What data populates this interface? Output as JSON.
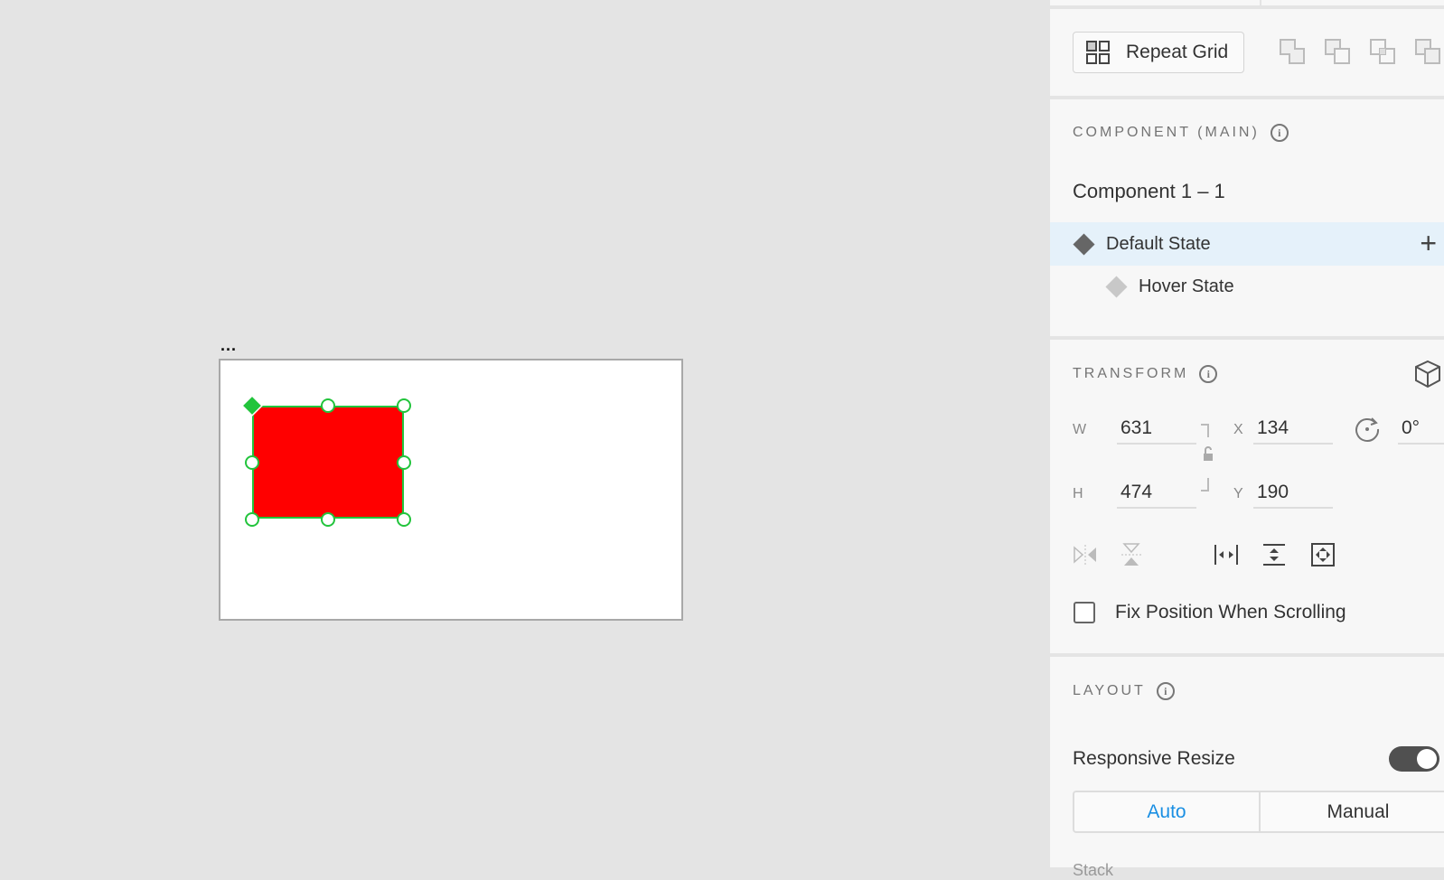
{
  "canvas": {
    "artboard_label": "...",
    "colors": {
      "shape_fill": "#ff0000",
      "selection": "#22c43c"
    }
  },
  "panel": {
    "repeat_grid_label": "Repeat Grid",
    "component": {
      "header": "COMPONENT (MAIN)",
      "name": "Component 1 – 1",
      "states": [
        {
          "label": "Default State",
          "selected": true
        },
        {
          "label": "Hover State",
          "selected": false
        }
      ]
    },
    "transform": {
      "header": "TRANSFORM",
      "w_label": "W",
      "w": "631",
      "h_label": "H",
      "h": "474",
      "x_label": "X",
      "x": "134",
      "y_label": "Y",
      "y": "190",
      "rotation": "0°",
      "fix_position_label": "Fix Position When Scrolling",
      "fix_position_checked": false
    },
    "layout": {
      "header": "LAYOUT",
      "responsive_resize_label": "Responsive Resize",
      "responsive_resize_on": true,
      "modes": [
        "Auto",
        "Manual"
      ],
      "active_mode": "Auto",
      "next_label": "Stack"
    }
  },
  "colors": {
    "accent": "#1a8fe3",
    "selected_row": "#e5f1fa"
  }
}
